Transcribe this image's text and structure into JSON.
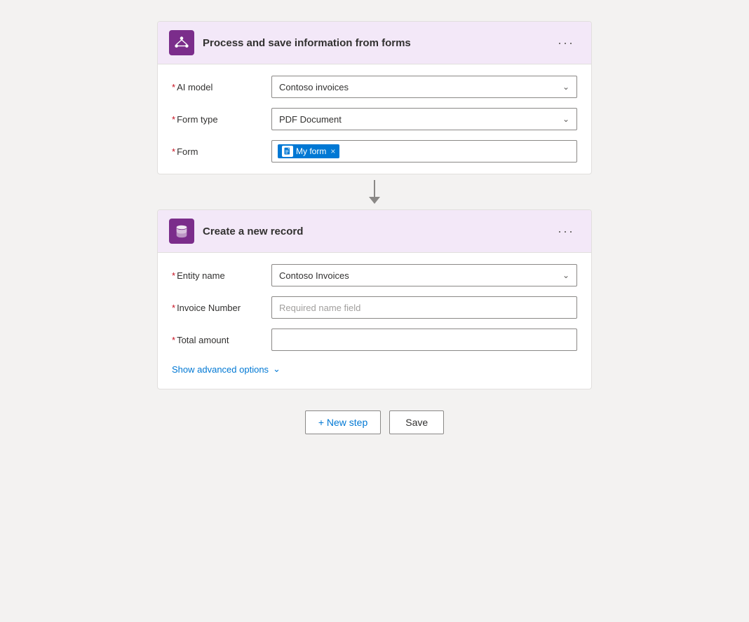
{
  "card1": {
    "title": "Process and save information from forms",
    "icon": "network-icon",
    "fields": {
      "ai_model": {
        "label": "AI model",
        "required": true,
        "value": "Contoso invoices"
      },
      "form_type": {
        "label": "Form type",
        "required": true,
        "value": "PDF Document"
      },
      "form": {
        "label": "Form",
        "required": true,
        "tag_label": "My form"
      }
    },
    "more_label": "···"
  },
  "card2": {
    "title": "Create a new record",
    "icon": "database-icon",
    "fields": {
      "entity_name": {
        "label": "Entity name",
        "required": true,
        "value": "Contoso Invoices"
      },
      "invoice_number": {
        "label": "Invoice Number",
        "required": true,
        "placeholder": "Required name field"
      },
      "total_amount": {
        "label": "Total amount",
        "required": true,
        "placeholder": ""
      }
    },
    "show_advanced": "Show advanced options",
    "more_label": "···"
  },
  "actions": {
    "new_step_label": "+ New step",
    "save_label": "Save"
  }
}
